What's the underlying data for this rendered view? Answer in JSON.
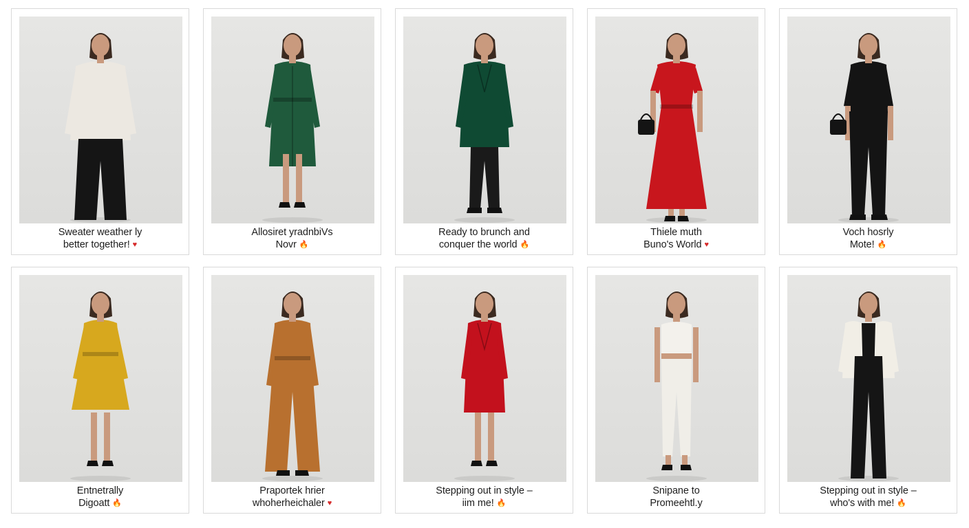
{
  "gallery": {
    "cards": [
      {
        "line1": "Sweater weather ly",
        "line2": "better together!",
        "emoji": "♥",
        "emoji_type": "heart",
        "outfit": {
          "top": "#ece8e1",
          "bottom": "#151515",
          "shoes": "#111111",
          "style": "sweater-pants",
          "bag": false
        }
      },
      {
        "line1": "Allosiret yradnbiVs",
        "line2": "Novr",
        "emoji": "🔥",
        "emoji_type": "fire",
        "outfit": {
          "top": "#1f5a3c",
          "bottom": "#1f5a3c",
          "shoes": "#111111",
          "style": "long-coat",
          "bag": false
        }
      },
      {
        "line1": "Ready to brunch and",
        "line2": "conquer the world",
        "emoji": "🔥",
        "emoji_type": "fire",
        "outfit": {
          "top": "#0f4a33",
          "bottom": "#1a1a1a",
          "shoes": "#111111",
          "style": "coat-pants",
          "bag": false
        }
      },
      {
        "line1": "Thiele muth",
        "line2": "Buno's World",
        "emoji": "♥",
        "emoji_type": "heart",
        "outfit": {
          "top": "#c8161d",
          "bottom": "#c8161d",
          "shoes": "#111111",
          "style": "dress",
          "bag": true
        }
      },
      {
        "line1": "Voch hosrly",
        "line2": "Mote!",
        "emoji": "🔥",
        "emoji_type": "fire",
        "outfit": {
          "top": "#141414",
          "bottom": "#141414",
          "shoes": "#111111",
          "style": "jumpsuit",
          "bag": true
        }
      },
      {
        "line1": "Entnetrally",
        "line2": "Digoatt",
        "emoji": "🔥",
        "emoji_type": "fire",
        "outfit": {
          "top": "#d7a81e",
          "bottom": "#d7a81e",
          "shoes": "#111111",
          "style": "short-dress",
          "bag": false
        }
      },
      {
        "line1": "Praportek hrier",
        "line2": "whoherheichaler",
        "emoji": "♥",
        "emoji_type": "heart",
        "outfit": {
          "top": "#b8702f",
          "bottom": "#b8702f",
          "shoes": "#111111",
          "style": "jumpsuit-wide",
          "bag": false
        }
      },
      {
        "line1": "Stepping out in style –",
        "line2": "iim me!",
        "emoji": "🔥",
        "emoji_type": "fire",
        "outfit": {
          "top": "#c3111d",
          "bottom": "#c3111d",
          "shoes": "#111111",
          "style": "short-coat",
          "bag": false
        }
      },
      {
        "line1": "Snipane to",
        "line2": "Promeehtl.y",
        "emoji": "",
        "emoji_type": "none",
        "outfit": {
          "top": "#f3f1ec",
          "bottom": "#f0eee8",
          "shoes": "#111111",
          "style": "top-pants",
          "bag": false
        }
      },
      {
        "line1": "Stepping out in style –",
        "line2": "who's with me!",
        "emoji": "🔥",
        "emoji_type": "fire",
        "outfit": {
          "top": "#f1eee6",
          "bottom": "#151515",
          "shoes": "#111111",
          "style": "blazer-pants",
          "bag": false
        }
      }
    ]
  },
  "colors": {
    "skin": "#c99a7e",
    "hair": "#3b2a20",
    "border": "#d9d9d9",
    "photo_bg": "#e2e2e0"
  }
}
